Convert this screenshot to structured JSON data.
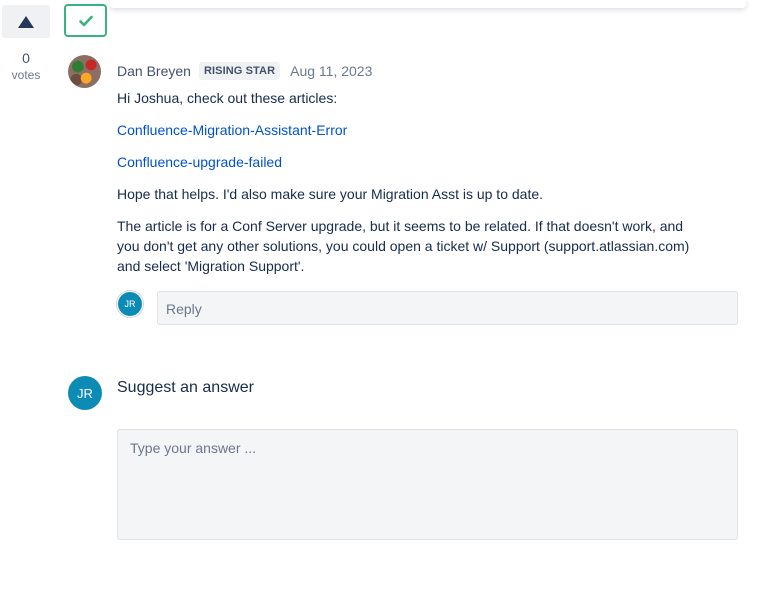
{
  "votes": {
    "count": "0",
    "label": "votes"
  },
  "answer": {
    "author": "Dan Breyen",
    "badge": "RISING STAR",
    "date": "Aug 11, 2023",
    "greeting": "Hi Joshua, check out these articles:",
    "link1": "Confluence-Migration-Assistant-Error",
    "link2": "Confluence-upgrade-failed",
    "para1": "Hope that helps.  I'd also make sure your Migration Asst is up to date.",
    "para2": "The article is for a Conf Server upgrade, but it seems to be related.  If that doesn't work, and you don't get any other solutions, you could open a ticket w/ Support (support.atlassian.com) and select 'Migration Support'."
  },
  "reply": {
    "avatar_initials": "JR",
    "placeholder": "Reply"
  },
  "suggest": {
    "avatar_initials": "JR",
    "heading": "Suggest an answer",
    "placeholder": "Type your answer ..."
  },
  "colors": {
    "accent": "#36b37e",
    "link": "#0052cc",
    "avatar": "#0c8bb5"
  },
  "icons": {
    "upvote": "triangle-up-icon",
    "accepted": "checkmark-icon"
  }
}
